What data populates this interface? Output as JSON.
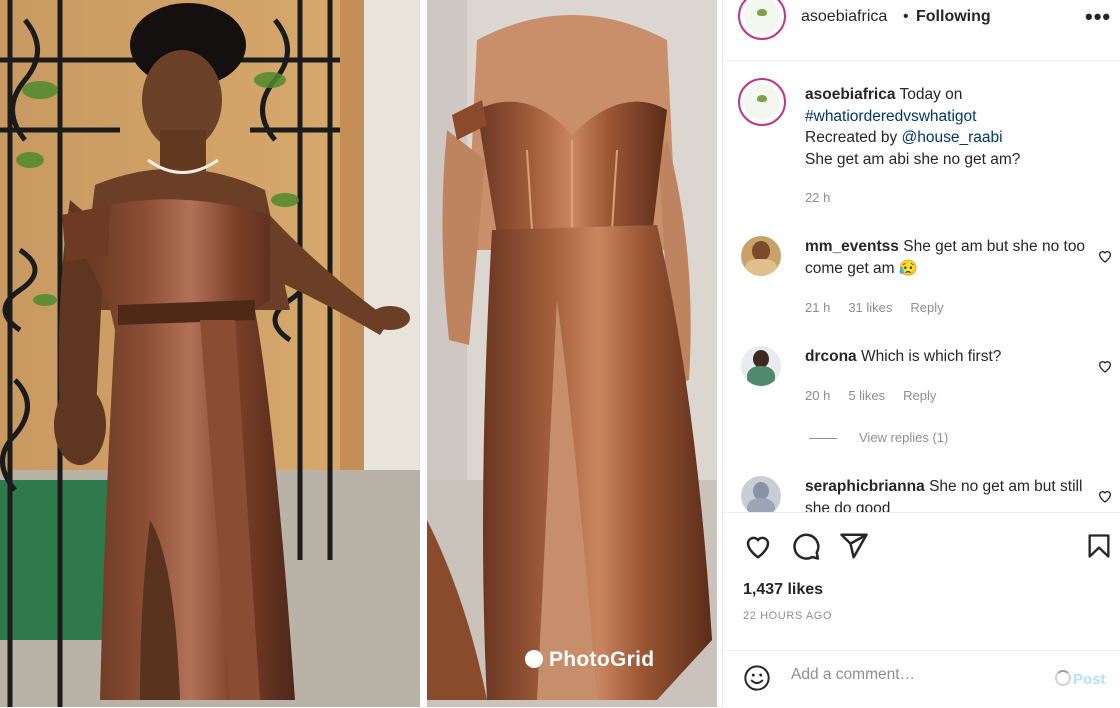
{
  "post": {
    "account": "asoebiafrica",
    "following_label": "Following",
    "more_label": "•••",
    "separator": "•",
    "watermark": "PhotoGrid"
  },
  "caption": {
    "username": "asoebiafrica",
    "line1": "Today on",
    "hashtag": "#whatiorderedvswhatigot",
    "line3_prefix": "Recreated by",
    "mention": "@house_raabi",
    "line4": "She get am abi she no get am?",
    "time": "22 h"
  },
  "comments": [
    {
      "username": "mm_eventss",
      "text": "She get am but she no too come get am 😥",
      "time": "21 h",
      "likes": "31 likes",
      "reply": "Reply"
    },
    {
      "username": "drcona",
      "text": "Which is which first?",
      "time": "20 h",
      "likes": "5 likes",
      "reply": "Reply",
      "view_replies": "View replies (1)"
    },
    {
      "username": "seraphicbrianna",
      "text": "She no get am but still she do good",
      "time": "",
      "likes": "",
      "reply": ""
    }
  ],
  "stats": {
    "likes": "1,437 likes",
    "posted": "22 HOURS AGO"
  },
  "add_comment": {
    "placeholder": "Add a comment…",
    "post_label": "Post"
  },
  "colors": {
    "story_ring": "#c13584",
    "link": "#00376b",
    "muted": "#8e8e8e",
    "post_button_disabled": "#b2dffc"
  },
  "icons": [
    "more-icon",
    "heart-icon",
    "comment-icon",
    "share-icon",
    "bookmark-icon",
    "emoji-icon",
    "loading-spinner-icon"
  ]
}
